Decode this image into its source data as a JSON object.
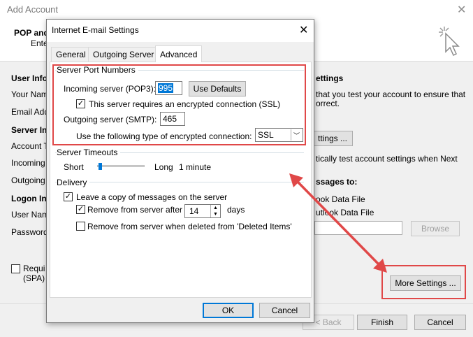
{
  "bg": {
    "title": "Add Account",
    "header_title": "POP and",
    "header_sub": "Ente",
    "user_info": "User Info",
    "your_name": "Your Nam",
    "email_address": "Email Add",
    "server_info": "Server Inf",
    "account_type": "Account T",
    "incoming": "Incoming",
    "outgoing": "Outgoing",
    "logon_info": "Logon Inf",
    "user_name": "User Nam",
    "password": "Password",
    "require_spa_1": "Requi",
    "require_spa_2": "(SPA)",
    "settings_heading": "ettings",
    "test_text_1": "that you test your account to ensure that",
    "test_text_2": "orrect.",
    "test_button": "ttings ...",
    "auto_test": "tically test account settings when Next",
    "deliver_heading": "ssages to:",
    "option_new_file": "ook Data File",
    "option_existing_file": "utlook Data File",
    "browse": "Browse",
    "more_settings": "More Settings ...",
    "back": "< Back",
    "finish": "Finish",
    "cancel": "Cancel"
  },
  "dialog": {
    "title": "Internet E-mail Settings",
    "tabs": [
      "General",
      "Outgoing Server",
      "Advanced"
    ],
    "server_port_numbers": "Server Port Numbers",
    "incoming_label": "Incoming server (POP3):",
    "incoming_value": "995",
    "use_defaults": "Use Defaults",
    "ssl_required": "This server requires an encrypted connection (SSL)",
    "outgoing_label": "Outgoing server (SMTP):",
    "outgoing_value": "465",
    "encryption_label": "Use the following type of encrypted connection:",
    "encryption_value": "SSL",
    "server_timeouts": "Server Timeouts",
    "short": "Short",
    "long": "Long",
    "timeout_value": "1 minute",
    "timeout_level": 0.05,
    "delivery": "Delivery",
    "leave_copy": "Leave a copy of messages on the server",
    "remove_after": "Remove from server after",
    "remove_days": "14",
    "days": "days",
    "remove_deleted": "Remove from server when deleted from 'Deleted Items'",
    "ok": "OK",
    "cancel": "Cancel"
  },
  "colors": {
    "annotation": "#e04848",
    "selection": "#0078d7"
  }
}
